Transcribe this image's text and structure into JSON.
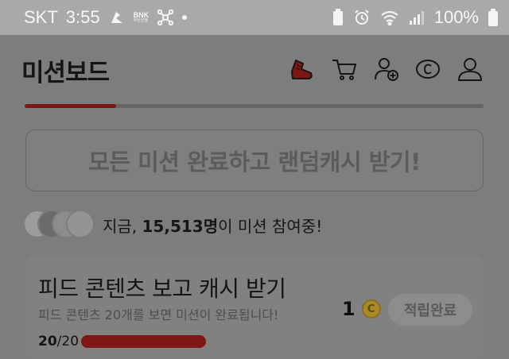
{
  "status_bar": {
    "carrier": "SKT",
    "time": "3:55",
    "bank_label": "BNK",
    "bank_sub": "부산은행",
    "battery": "100%"
  },
  "header": {
    "title": "미션보드",
    "icons": [
      "shoe-icon",
      "cart-icon",
      "add-friend-icon",
      "coin-icon",
      "profile-icon"
    ]
  },
  "progress": {
    "fraction": 0.2
  },
  "banner": {
    "text": "모든 미션 완료하고 랜덤캐시 받기!"
  },
  "participants": {
    "prefix": "지금, ",
    "count": "15,513명",
    "suffix": "이 미션 참여중!"
  },
  "mission": {
    "title": "피드 콘텐츠 보고 캐시 받기",
    "subtitle": "피드 콘텐츠 20개를 보면 미션이 완료됩니다!",
    "reward": "1",
    "coin_symbol": "C",
    "button": "적립완료",
    "progress_current": "20",
    "progress_total": "/20",
    "progress_fraction": 1.0
  },
  "colors": {
    "accent": "#7c1716",
    "status_bg": "#a9a9a9",
    "overlay_bg": "#7d7d7d"
  }
}
